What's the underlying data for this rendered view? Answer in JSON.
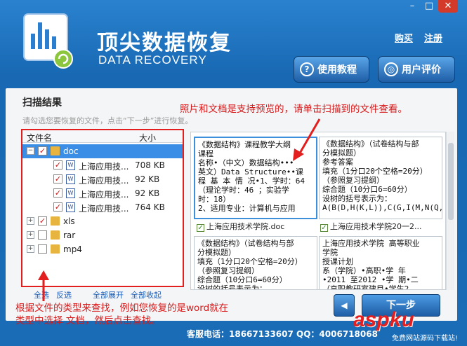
{
  "window": {
    "min": "–",
    "max": "□",
    "close": "✕"
  },
  "header": {
    "title_cn": "顶尖数据恢复",
    "title_en": "DATA RECOVERY",
    "buy": "购买",
    "register": "注册",
    "tutorial_btn": "使用教程",
    "review_btn": "用户评价"
  },
  "panel": {
    "title": "扫描结果",
    "hint": "请勾选您要恢复的文件，点击“下一步”进行恢复。",
    "note_top": "照片和文档是支持预览的，请单击扫描到的文件查看。",
    "note_bottom_1": "根据文件的类型来查找，例如您恢复的是word就在",
    "note_bottom_2": "类型中选择 文档，然后点击查找。"
  },
  "tree": {
    "col_name": "文件名",
    "col_size": "大小",
    "rows": [
      {
        "label": "doc",
        "size": ""
      },
      {
        "label": "上海应用技...",
        "size": "708 KB"
      },
      {
        "label": "上海应用技...",
        "size": "92 KB"
      },
      {
        "label": "上海应用技...",
        "size": "92 KB"
      },
      {
        "label": "上海应用技...",
        "size": "764 KB"
      },
      {
        "label": "xls",
        "size": ""
      },
      {
        "label": "rar",
        "size": ""
      },
      {
        "label": "mp4",
        "size": ""
      }
    ],
    "links": {
      "select_all": "全选",
      "invert": "反选",
      "expand": "全部展开",
      "collapse": "全部收起"
    }
  },
  "preview": {
    "cards": [
      {
        "text": "《数据结构》课程教学大纲\n课程\n名称•（中文）数据结构•••\n英文）Data Structure••课\n程 基 本 情 况•1、学时：64\n（理论学时：46 ；实验学\n时：18）\n2、适用专业：计算机与应用",
        "label": "上海应用技术学院.doc"
      },
      {
        "text": "《数据结构》（试卷结构与部\n分模拟题）\n参考答案\n填充（1分口20个空格=20分）\n（参照复习提纲）\n综合题（10分口6=60分）\n设树的括号表示为：\nA(B(D,H(K,L)),C(G,I(M,N(Q,",
        "label": "上海应用技术学院20一2..."
      },
      {
        "text": "《数据结构》（试卷结构与部\n分模拟题）\n填充（1分口20个空格=20分）\n（参照复习提纲）\n综合题（10分口6=60分）\n设树的括号表示为：",
        "label": ""
      },
      {
        "text": "上海应用技术学院  高等职业\n学院\n授课计划\n系（学院）•高职•学  年\n•2011    至2012 •学  期•二\n（高职教研室建目•学生2",
        "label": ""
      }
    ]
  },
  "nav": {
    "back": "◀",
    "next": "下一步"
  },
  "status": "客服电话：18667133607  QQ：4006718068",
  "watermark": {
    "brand": "aspku",
    "sub": "免费网站源码下载站!"
  },
  "colors": {
    "accent": "#1868b3",
    "red": "#e21e1e",
    "select": "#3a8ee6"
  }
}
